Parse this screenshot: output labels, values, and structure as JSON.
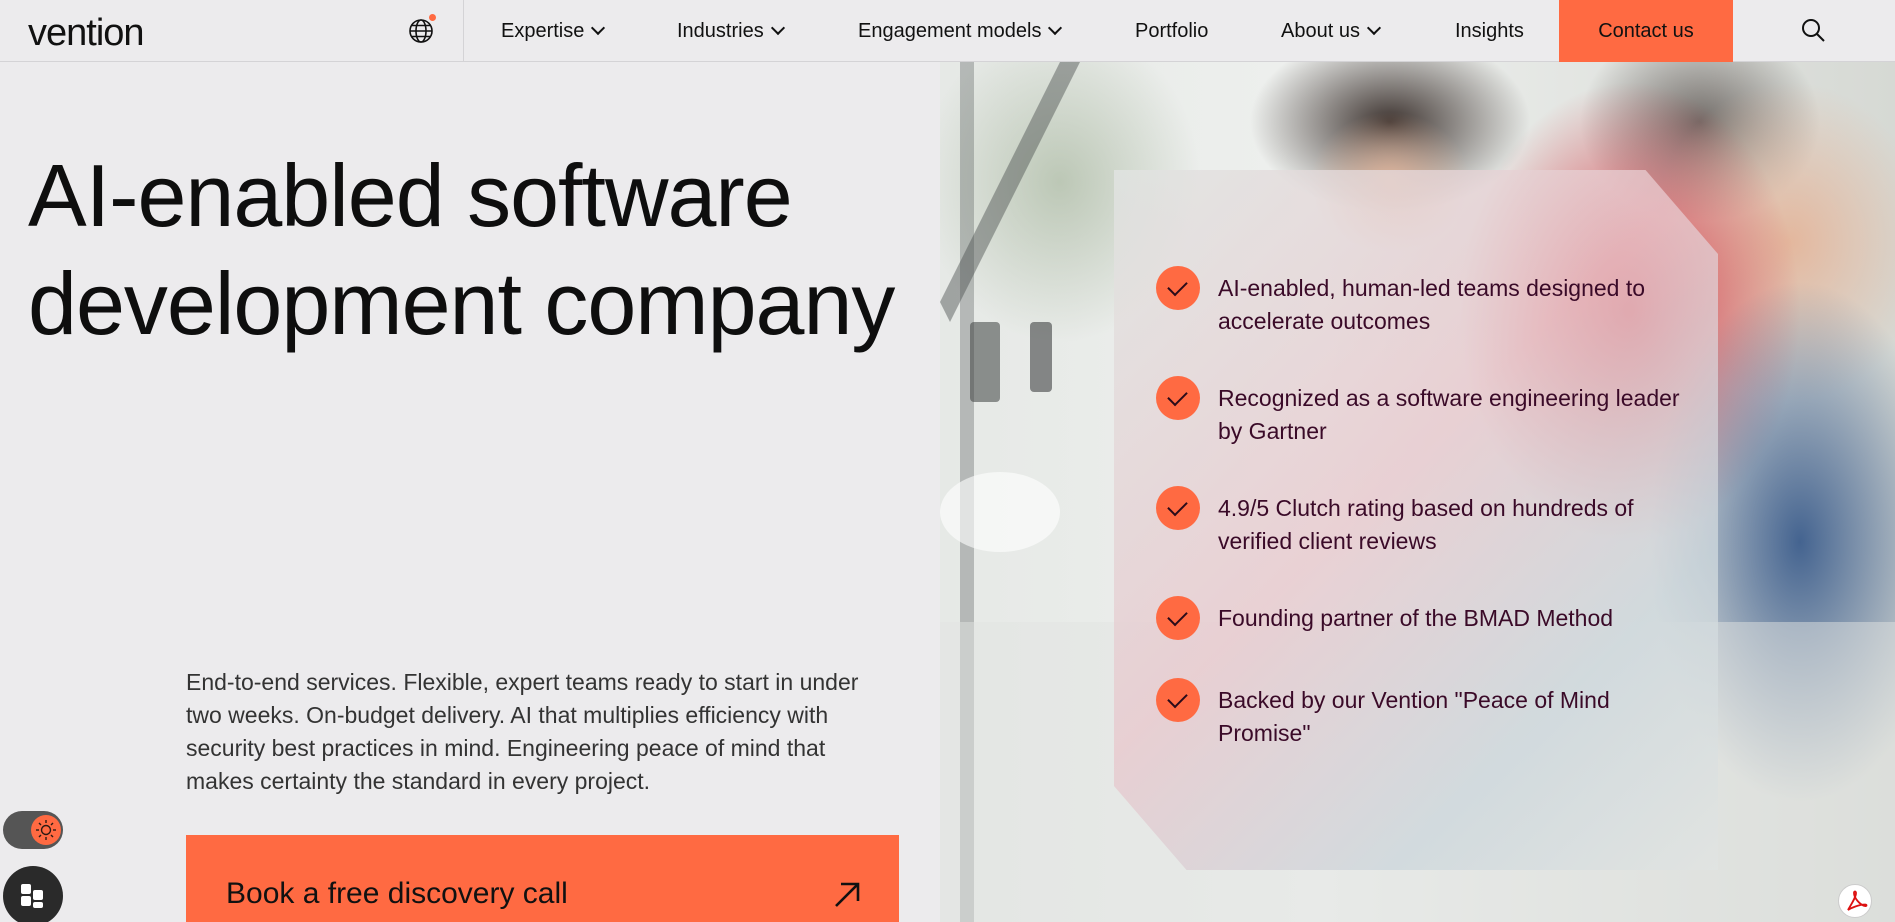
{
  "nav": {
    "logo": "vention",
    "items": [
      {
        "label": "Expertise",
        "dropdown": true
      },
      {
        "label": "Industries",
        "dropdown": true
      },
      {
        "label": "Engagement models",
        "dropdown": true
      },
      {
        "label": "Portfolio",
        "dropdown": false
      },
      {
        "label": "About us",
        "dropdown": true
      },
      {
        "label": "Insights",
        "dropdown": false
      }
    ],
    "contact_label": "Contact us"
  },
  "hero": {
    "title": "AI-enabled software development company",
    "description": "End-to-end services. Flexible, expert teams ready to start in under two weeks. On-budget delivery. AI that multiplies efficiency with security best practices in mind. Engineering peace of mind that makes certainty the standard in every project.",
    "cta_label": "Book a free discovery call"
  },
  "features": [
    "AI-enabled, human-led teams designed to accelerate outcomes",
    "Recognized as a software engineering leader by Gartner",
    "4.9/5 Clutch rating based on hundreds of verified client reviews",
    "Founding partner of the BMAD Method",
    "Backed by our Vention \"Peace of Mind Promise\""
  ],
  "icons": {
    "globe": "globe-icon",
    "search": "search-icon",
    "cta_arrow": "arrow-up-right-icon",
    "check": "check-icon",
    "theme": "sun-icon",
    "accessibility": "accessibility-icon",
    "pdf": "pdf-icon"
  },
  "colors": {
    "accent": "#ff6a42",
    "background": "#ecebed",
    "feature_text": "#3a0a28"
  }
}
